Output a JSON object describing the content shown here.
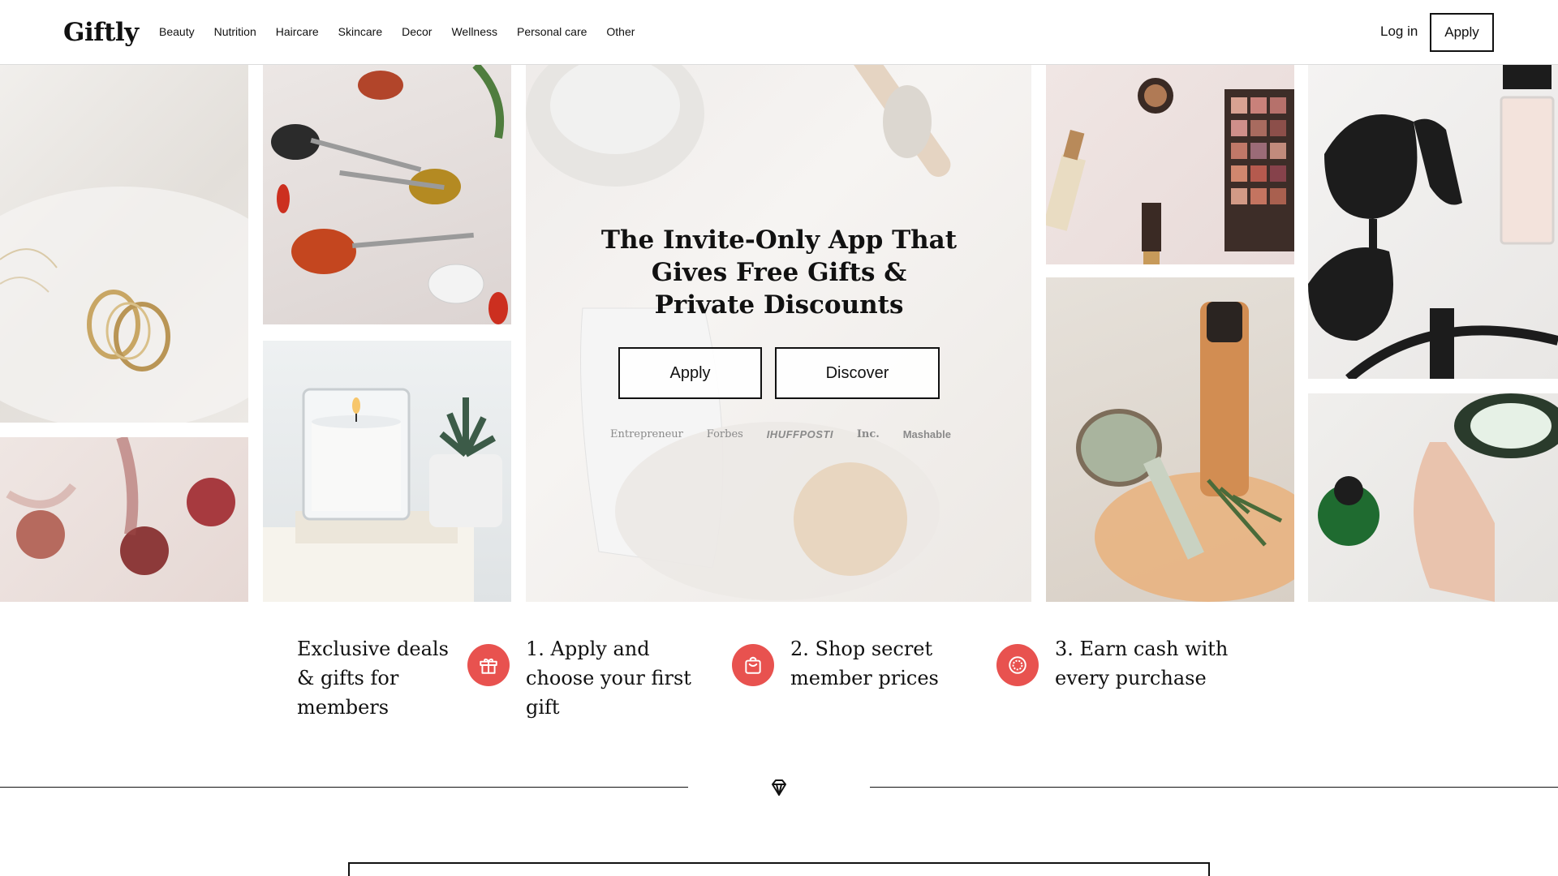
{
  "header": {
    "logo": "Giftly",
    "nav": [
      "Beauty",
      "Nutrition",
      "Haircare",
      "Skincare",
      "Decor",
      "Wellness",
      "Personal care",
      "Other"
    ],
    "login_label": "Log in",
    "apply_label": "Apply"
  },
  "hero": {
    "headline": "The Invite-Only App That Gives Free Gifts & Private Discounts",
    "apply_label": "Apply",
    "discover_label": "Discover",
    "press": [
      "Entrepreneur",
      "Forbes",
      "IHUFFPOSTI",
      "Inc.",
      "Mashable"
    ]
  },
  "features": {
    "intro": "Exclusive deals & gifts for members",
    "steps": [
      {
        "label": "1. Apply and choose your first gift",
        "icon": "gift-icon"
      },
      {
        "label": "2. Shop secret member prices",
        "icon": "shopping-bag-icon"
      },
      {
        "label": "3. Earn cash with every purchase",
        "icon": "coin-icon"
      }
    ],
    "accent_color": "#e8524f"
  },
  "divider": {
    "icon": "diamond-icon"
  }
}
